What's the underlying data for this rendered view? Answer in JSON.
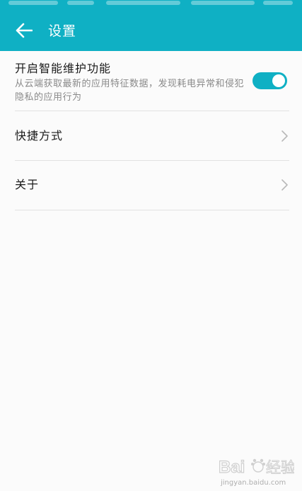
{
  "header": {
    "title": "设置",
    "back_icon": "arrow-left-icon",
    "color": "#0fb0c4"
  },
  "settings": [
    {
      "title": "开启智能维护功能",
      "subtitle": "从云端获取最新的应用特征数据，发现耗电异常和侵犯隐私的应用行为",
      "control": "toggle",
      "enabled": true
    },
    {
      "title": "快捷方式",
      "control": "chevron-right-icon"
    },
    {
      "title": "关于",
      "control": "chevron-right-icon"
    }
  ],
  "watermark": {
    "text": "jingyan.baidu.com"
  }
}
